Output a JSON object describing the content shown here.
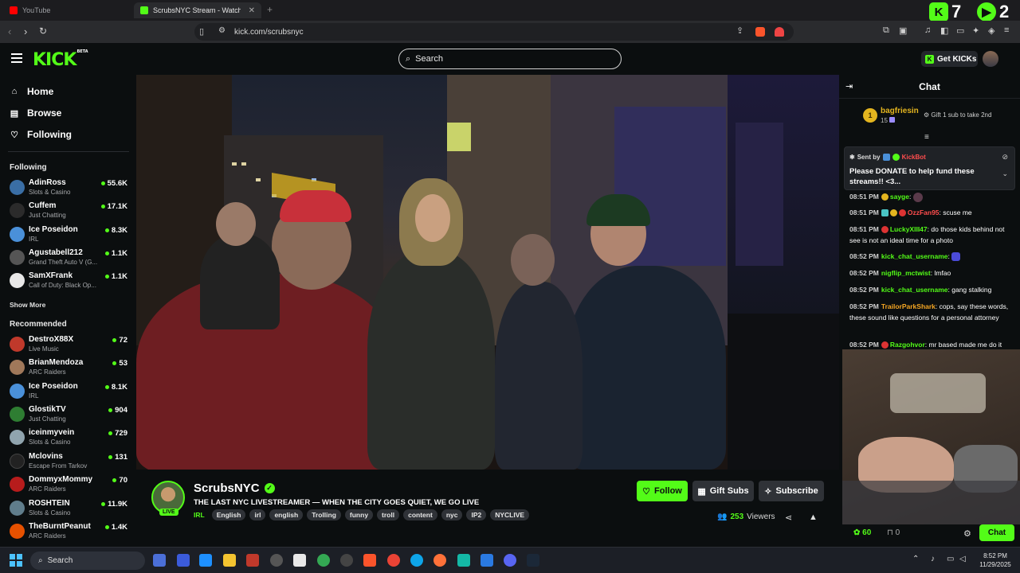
{
  "browser": {
    "tabs": [
      {
        "label": "YouTube",
        "active": false
      },
      {
        "label": "ScrubsNYC Stream - Watch Li...",
        "active": true
      }
    ],
    "url": "kick.com/scrubsnyc",
    "counters": [
      {
        "icon": "kick-icon",
        "value": "7",
        "color": "#53fc18"
      },
      {
        "icon": "play-icon",
        "value": "2",
        "color": "#53fc18"
      }
    ]
  },
  "header": {
    "logo": "KICK",
    "logo_sup": "BETA",
    "search_placeholder": "Search",
    "get_kicks": "Get KICKs"
  },
  "sidebar": {
    "nav": [
      {
        "label": "Home",
        "icon": "home-icon"
      },
      {
        "label": "Browse",
        "icon": "browse-icon"
      },
      {
        "label": "Following",
        "icon": "heart-icon"
      }
    ],
    "following_title": "Following",
    "following": [
      {
        "name": "AdinRoss",
        "category": "Slots & Casino",
        "viewers": "55.6K",
        "color": "#3a6ea5"
      },
      {
        "name": "Cuffem",
        "category": "Just Chatting",
        "viewers": "17.1K",
        "color": "#2b2b2b"
      },
      {
        "name": "Ice Poseidon",
        "category": "IRL",
        "viewers": "8.3K",
        "color": "#4a90d9"
      },
      {
        "name": "Agustabell212",
        "category": "Grand Theft Auto V (G...",
        "viewers": "1.1K",
        "color": "#555555"
      },
      {
        "name": "SamXFrank",
        "category": "Call of Duty: Black Op...",
        "viewers": "1.1K",
        "color": "#e8e8e8"
      }
    ],
    "show_more": "Show More",
    "recommended_title": "Recommended",
    "recommended": [
      {
        "name": "DestroX88X",
        "category": "Live Music",
        "viewers": "72",
        "color": "#c0392b"
      },
      {
        "name": "BrianMendoza",
        "category": "ARC Raiders",
        "viewers": "53",
        "color": "#a0785a"
      },
      {
        "name": "Ice Poseidon",
        "category": "IRL",
        "viewers": "8.1K",
        "color": "#4a90d9"
      },
      {
        "name": "GlostikTV",
        "category": "Just Chatting",
        "viewers": "904",
        "color": "#2e7d32"
      },
      {
        "name": "iceinmyvein",
        "category": "Slots & Casino",
        "viewers": "729",
        "color": "#90a4ae"
      },
      {
        "name": "Mclovins",
        "category": "Escape From Tarkov",
        "viewers": "131",
        "color": "#222222"
      },
      {
        "name": "DommyxMommy",
        "category": "ARC Raiders",
        "viewers": "70",
        "color": "#b71c1c"
      },
      {
        "name": "ROSHTEIN",
        "category": "Slots & Casino",
        "viewers": "11.9K",
        "color": "#607d8b"
      },
      {
        "name": "TheBurntPeanut",
        "category": "ARC Raiders",
        "viewers": "1.4K",
        "color": "#e65100"
      }
    ]
  },
  "stream": {
    "name": "ScrubsNYC",
    "live": "LIVE",
    "title": "THE LAST NYC LIVESTREAMER — WHEN THE CITY GOES QUIET, WE GO LIVE",
    "category": "IRL",
    "tags": [
      "English",
      "irl",
      "english",
      "Trolling",
      "funny",
      "troll",
      "content",
      "nyc",
      "IP2",
      "NYCLIVE"
    ],
    "follow": "Follow",
    "gift_subs": "Gift Subs",
    "subscribe": "Subscribe",
    "viewers": "253",
    "viewers_label": "Viewers"
  },
  "chat": {
    "title": "Chat",
    "top_gifter": {
      "rank": "1",
      "name": "bagfriesin",
      "count": "15",
      "message": "Gift 1 sub to take 2nd"
    },
    "pinned": {
      "sent_by": "Sent by",
      "bot": "KickBot",
      "message": "Please DONATE to help fund these streams!! <3..."
    },
    "messages": [
      {
        "time": "08:51 PM",
        "user": "sayge",
        "color": "#53fc18",
        "text": ""
      },
      {
        "time": "08:51 PM",
        "user": "OzzFan95",
        "color": "#ff4d4d",
        "text": "scuse me"
      },
      {
        "time": "08:51 PM",
        "user": "LuckyXIII47",
        "color": "#53fc18",
        "text": "do those kids behind not see is not an ideal time for a photo"
      },
      {
        "time": "08:52 PM",
        "user": "kick_chat_username",
        "color": "#53fc18",
        "text": ""
      },
      {
        "time": "08:52 PM",
        "user": "nigflip_mctwist",
        "color": "#53fc18",
        "text": "lmfao"
      },
      {
        "time": "08:52 PM",
        "user": "kick_chat_username",
        "color": "#53fc18",
        "text": "gang stalking"
      },
      {
        "time": "08:52 PM",
        "user": "TrailorParkShark",
        "color": "#f5a623",
        "text": "cops, say these words, these sound like questions for a personal attorney"
      },
      {
        "time": "08:52 PM",
        "user": "Razgohvor",
        "color": "#53fc18",
        "text": "mr based made me do it"
      }
    ],
    "points": "60",
    "zero": "0",
    "send": "Chat"
  },
  "taskbar": {
    "search": "Search",
    "time": "8:52 PM",
    "date": "11/29/2025"
  }
}
